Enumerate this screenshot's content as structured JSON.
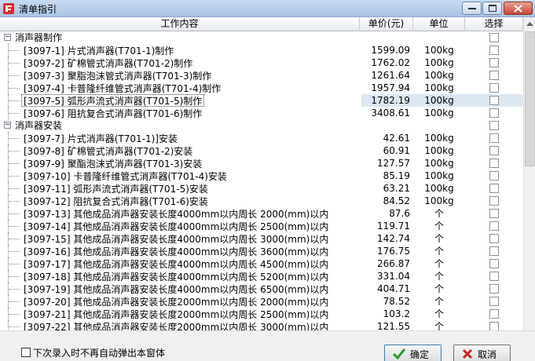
{
  "window": {
    "title": "清单指引",
    "controls": [
      "minimize",
      "maximize",
      "close"
    ]
  },
  "columns": {
    "name": "工作内容",
    "price": "单价(元)",
    "unit": "单位",
    "select": "选择"
  },
  "groups": [
    {
      "label": "消声器制作",
      "expander": "−",
      "items": [
        {
          "code": "[3097-1]",
          "name": "片式消声器(T701-1)制作",
          "price": "1599.09",
          "unit": "100kg",
          "selected": false
        },
        {
          "code": "[3097-2]",
          "name": "矿棉管式消声器(T701-2)制作",
          "price": "1762.02",
          "unit": "100kg",
          "selected": false
        },
        {
          "code": "[3097-3]",
          "name": "聚脂泡沫管式消声器(T701-3)制作",
          "price": "1261.64",
          "unit": "100kg",
          "selected": false
        },
        {
          "code": "[3097-4]",
          "name": "卡普隆纤维管式消声器(T701-4)制作",
          "price": "1957.94",
          "unit": "100kg",
          "selected": false
        },
        {
          "code": "[3097-5]",
          "name": "弧形声流式消声器(T701-5)制作",
          "price": "1782.19",
          "unit": "100kg",
          "selected": true
        },
        {
          "code": "[3097-6]",
          "name": "阻抗复合式消声器(T701-6)制作",
          "price": "3408.61",
          "unit": "100kg",
          "selected": false
        }
      ]
    },
    {
      "label": "消声器安装",
      "expander": "−",
      "items": [
        {
          "code": "[3097-7]",
          "name": "片式消声器(T701-1)]安装",
          "price": "42.61",
          "unit": "100kg",
          "selected": false
        },
        {
          "code": "[3097-8]",
          "name": "矿棉管式消声器(T701-2)安装",
          "price": "60.91",
          "unit": "100kg",
          "selected": false
        },
        {
          "code": "[3097-9]",
          "name": "聚酯泡沫式消声器(T701-3)安装",
          "price": "127.57",
          "unit": "100kg",
          "selected": false
        },
        {
          "code": "[3097-10]",
          "name": "卡普隆纤维管式消声器(T701-4)安装",
          "price": "85.19",
          "unit": "100kg",
          "selected": false
        },
        {
          "code": "[3097-11]",
          "name": "弧形声流式消声器(T701-5)安装",
          "price": "63.21",
          "unit": "100kg",
          "selected": false
        },
        {
          "code": "[3097-12]",
          "name": "阻抗复合式消声器(T701-6)安装",
          "price": "84.52",
          "unit": "100kg",
          "selected": false
        },
        {
          "code": "[3097-13]",
          "name": "其他成品消声器安装长度4000mm以内周长 2000(mm)以内",
          "price": "87.6",
          "unit": "个",
          "selected": false
        },
        {
          "code": "[3097-14]",
          "name": "其他成品消声器安装长度4000mm以内周长 2500(mm)以内",
          "price": "119.71",
          "unit": "个",
          "selected": false
        },
        {
          "code": "[3097-15]",
          "name": "其他成品消声器安装长度4000mm以内周长 3000(mm)以内",
          "price": "142.74",
          "unit": "个",
          "selected": false
        },
        {
          "code": "[3097-16]",
          "name": "其他成品消声器安装长度4000mm以内周长 3600(mm)以内",
          "price": "176.75",
          "unit": "个",
          "selected": false
        },
        {
          "code": "[3097-17]",
          "name": "其他成品消声器安装长度4000mm以内周长 4500(mm)以内",
          "price": "266.87",
          "unit": "个",
          "selected": false
        },
        {
          "code": "[3097-18]",
          "name": "其他成品消声器安装长度4000mm以内周长 5200(mm)以内",
          "price": "331.04",
          "unit": "个",
          "selected": false
        },
        {
          "code": "[3097-19]",
          "name": "其他成品消声器安装长度4000mm以内周长 6500(mm)以内",
          "price": "404.71",
          "unit": "个",
          "selected": false
        },
        {
          "code": "[3097-20]",
          "name": "其他成品消声器安装长度2000mm以内周长 2000(mm)以内",
          "price": "78.52",
          "unit": "个",
          "selected": false
        },
        {
          "code": "[3097-21]",
          "name": "其他成品消声器安装长度2000mm以内周长 2500(mm)以内",
          "price": "103.2",
          "unit": "个",
          "selected": false
        },
        {
          "code": "[3097-22]",
          "name": "其他成品消声器安装长度2000mm以内周长 3000(mm)以内",
          "price": "121.55",
          "unit": "个",
          "selected": false
        }
      ]
    }
  ],
  "footer": {
    "dont_show_label": "下次录入时不再自动弹出本窗体",
    "dont_show_checked": false,
    "ok_label": "确定",
    "cancel_label": "取消"
  },
  "colors": {
    "titlebar": "#b9cfed",
    "selected_row": "#dde7f3",
    "ok_icon": "#2e9a2e",
    "cancel_icon": "#c0281e"
  },
  "icons": {
    "app": "app-icon",
    "ok": "checkmark-icon",
    "cancel": "x-icon"
  }
}
